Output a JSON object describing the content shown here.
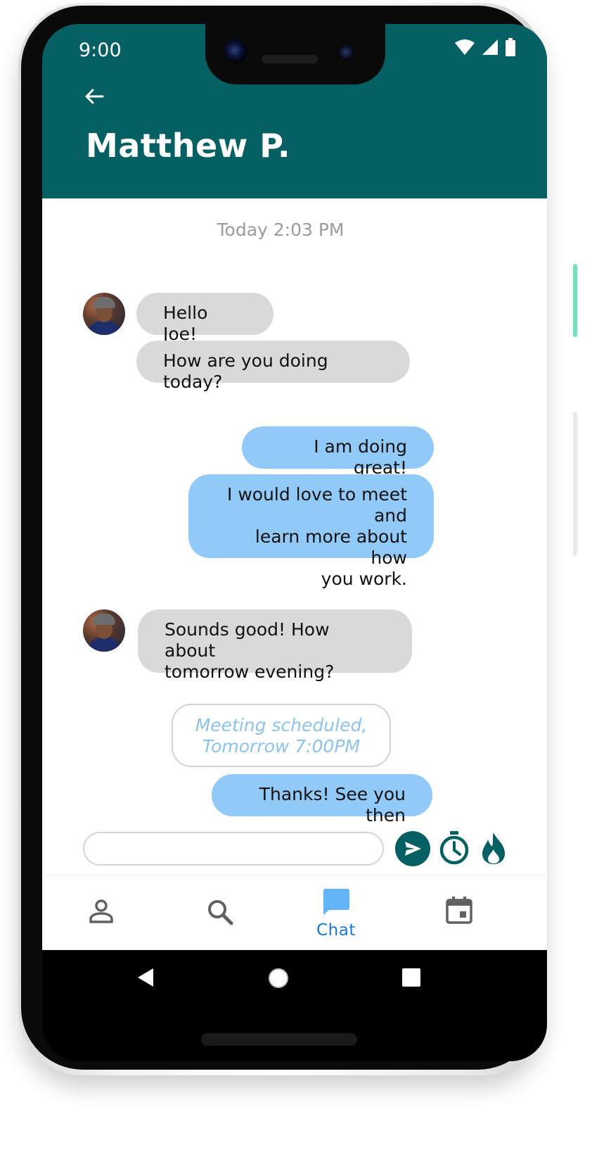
{
  "status_bar": {
    "time": "9:00",
    "icons": [
      "wifi-icon",
      "cell-signal-icon",
      "battery-icon"
    ]
  },
  "header": {
    "back_icon": "arrow-left-icon",
    "title": "Matthew P.",
    "background_color": "#046062"
  },
  "chat": {
    "timestamp": "Today 2:03 PM",
    "messages": [
      {
        "direction": "incoming",
        "text": "Hello Joe!"
      },
      {
        "direction": "incoming",
        "text": "How are you doing today?"
      },
      {
        "direction": "outgoing",
        "text": "I am doing great!"
      },
      {
        "direction": "outgoing",
        "text": "I would love to meet and\nlearn more about how\nyou work."
      },
      {
        "direction": "incoming",
        "text": "Sounds good! How about\ntomorrow evening?"
      },
      {
        "direction": "system",
        "text": "Meeting scheduled,\nTomorrow 7:00PM"
      },
      {
        "direction": "outgoing",
        "text": "Thanks! See you then"
      }
    ],
    "incoming_bubble_color": "#d9d9d9",
    "outgoing_bubble_color": "#91caf8"
  },
  "composer": {
    "input_value": "",
    "placeholder": "",
    "send_icon": "send-icon",
    "timer_icon": "timer-icon",
    "flame_icon": "flame-icon"
  },
  "bottom_nav": {
    "items": [
      {
        "icon": "person-icon",
        "label": "",
        "active": false
      },
      {
        "icon": "search-icon",
        "label": "",
        "active": false
      },
      {
        "icon": "chat-icon",
        "label": "Chat",
        "active": true
      },
      {
        "icon": "calendar-icon",
        "label": "",
        "active": false
      }
    ],
    "active_color": "#1976d2"
  },
  "system_nav": {
    "buttons": [
      "back-triangle-icon",
      "home-circle-icon",
      "recents-square-icon"
    ]
  }
}
